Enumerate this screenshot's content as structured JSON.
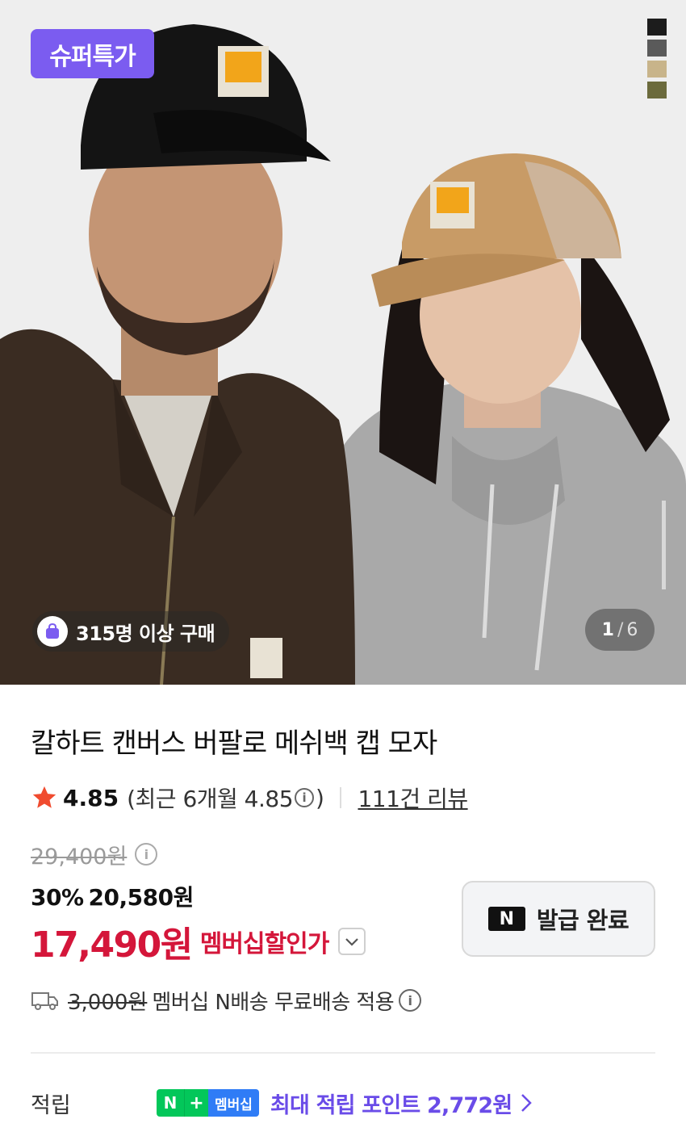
{
  "hero": {
    "badge": "슈퍼특가",
    "buyers_text": "315명 이상 구매",
    "pager": {
      "current": "1",
      "separator": "/",
      "total": "6"
    },
    "swatch_colors": [
      "#1c1c1c",
      "#5a5a5a",
      "#c8b48a",
      "#6b6a3c"
    ]
  },
  "product": {
    "title": "칼하트 캔버스 버팔로 메쉬백 캡 모자"
  },
  "rating": {
    "score": "4.85",
    "recent_prefix": "(최근 6개월 4.85",
    "recent_suffix": ")",
    "review_link": "111건 리뷰"
  },
  "price": {
    "original": "29,400원",
    "discount_percent": "30%",
    "discount_price": "20,580원",
    "member_price": "17,490원",
    "member_label": "멤버십할인가"
  },
  "coupon": {
    "logo": "N",
    "label": "발급 완료"
  },
  "shipping": {
    "old_fee": "3,000원",
    "text": "멤버십 N배송 무료배송 적용"
  },
  "points": {
    "label": "적립",
    "badge_n": "N",
    "badge_plus": "+",
    "badge_member": "멤버십",
    "text": "최대 적립 포인트 2,772원"
  },
  "icons": {
    "info": "i",
    "star": "star-icon",
    "truck": "truck-icon",
    "chevron": "chevron-right-icon"
  }
}
